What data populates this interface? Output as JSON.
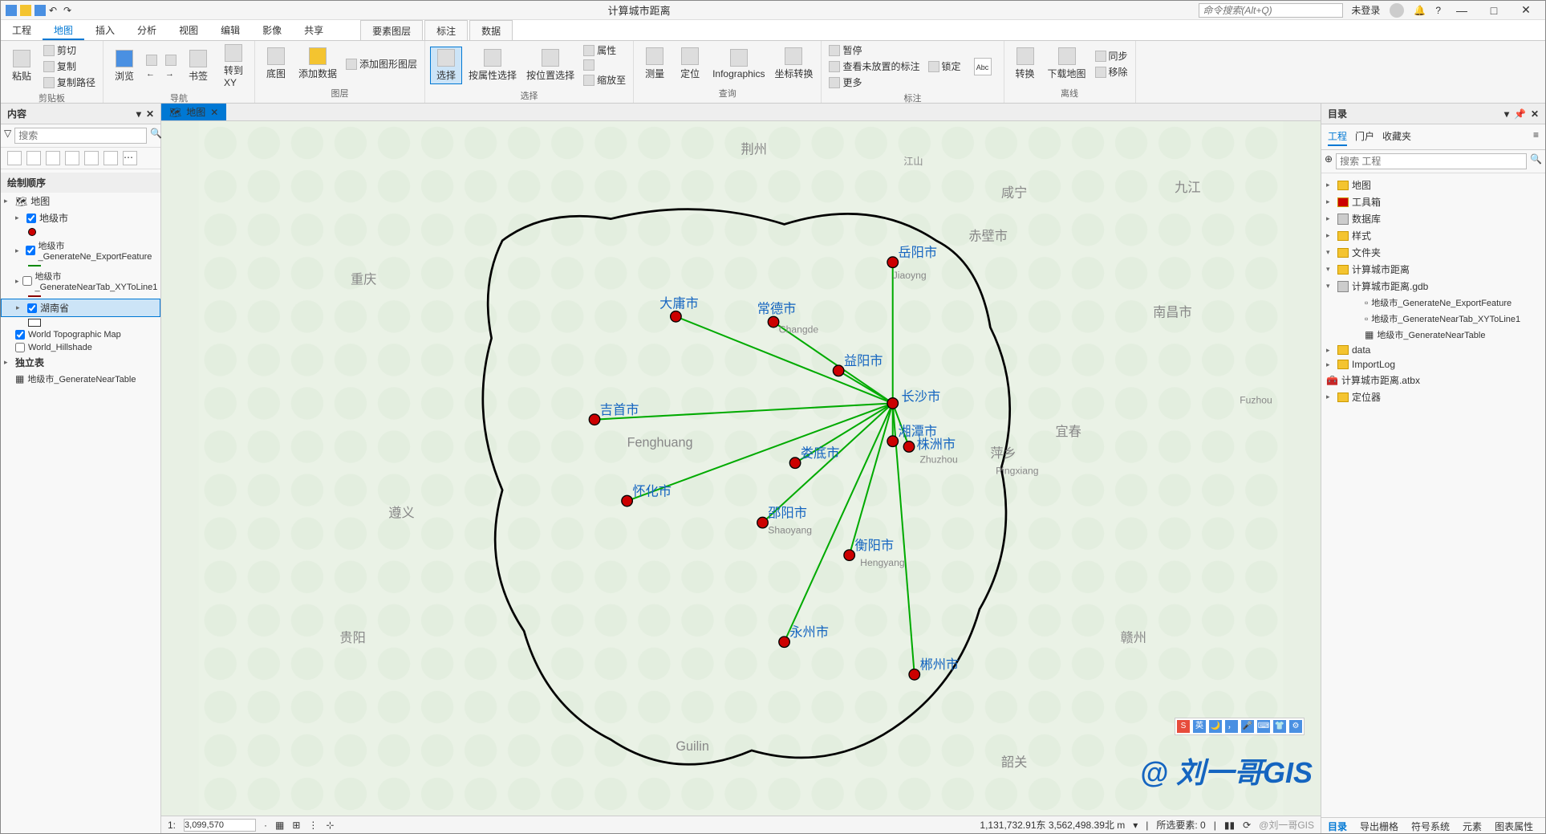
{
  "title": "计算城市距离",
  "search_placeholder": "命令搜索(Alt+Q)",
  "login": "未登录",
  "tabs": {
    "t0": "工程",
    "t1": "地图",
    "t2": "插入",
    "t3": "分析",
    "t4": "视图",
    "t5": "编辑",
    "t6": "影像",
    "t7": "共享",
    "c1": "要素图层",
    "c2": "标注",
    "c3": "数据"
  },
  "ribbon": {
    "clipboard": {
      "label": "剪贴板",
      "paste": "粘贴",
      "cut": "剪切",
      "copy": "复制",
      "copypath": "复制路径"
    },
    "nav": {
      "label": "导航",
      "browse": "浏览",
      "bookmark": "书签",
      "goto": "转到\nXY"
    },
    "layer": {
      "label": "图层",
      "basemap": "底图",
      "adddata": "添加数据",
      "addgfx": "添加图形图层"
    },
    "sel": {
      "label": "选择",
      "select": "选择",
      "byattr": "按属性选择",
      "byloc": "按位置选择",
      "attr": "属性",
      "zoomto": "缩放至"
    },
    "query": {
      "label": "查询",
      "measure": "测量",
      "locate": "定位",
      "info": "Infographics",
      "coord": "坐标转换"
    },
    "annot": {
      "label": "标注",
      "pause": "暂停",
      "lock": "锁定",
      "unplaced": "查看未放置的标注",
      "more": "更多"
    },
    "offline": {
      "label": "离线",
      "convert": "转换",
      "download": "下载地图",
      "sync": "同步",
      "remove": "移除"
    }
  },
  "contents": {
    "title": "内容",
    "search": "搜索",
    "draworder": "绘制顺序",
    "map": "地图",
    "layers": {
      "l1": "地级市",
      "l2": "地级市_GenerateNe_ExportFeature",
      "l3": "地级市_GenerateNearTab_XYToLine1",
      "l4": "湖南省",
      "l5": "World Topographic Map",
      "l6": "World_Hillshade"
    },
    "standalone": "独立表",
    "table1": "地级市_GenerateNearTable"
  },
  "maptab": "地图",
  "cities": {
    "c1": "岳阳市",
    "c2": "大庸市",
    "c3": "常德市",
    "c4": "益阳市",
    "c5": "长沙市",
    "c6": "吉首市",
    "c7": "株洲市",
    "c8": "娄底市",
    "c9": "怀化市",
    "c10": "邵阳市",
    "c11": "衡阳市",
    "c12": "永州市",
    "c13": "郴州市",
    "c14": "湘潭市"
  },
  "bgcities": {
    "b1": "重庆",
    "b2": "贵阳",
    "b3": "南昌市",
    "b4": "咸宁",
    "b5": "宜春",
    "b6": "萍乡",
    "b7": "韶关",
    "b8": "九江",
    "b9": "赤壁市",
    "b10": "遵义",
    "b11": "Fenghuang",
    "b12": "Guilin",
    "b13": "荆州",
    "b14": "江山",
    "b15": "Pingxiang",
    "b16": "Hengyang",
    "b17": "Zhuzhou",
    "b18": "Changde",
    "b19": "赣州",
    "b20": "Fuzhou",
    "b21": "Shaoyang",
    "b22": "Jiaoyng"
  },
  "status": {
    "scale_prefix": "1:",
    "scale": "3,099,570",
    "coords": "1,131,732.91东 3,562,498.39北 m",
    "selected": "所选要素: 0"
  },
  "catalog": {
    "title": "目录",
    "tabs": {
      "t1": "工程",
      "t2": "门户",
      "t3": "收藏夹"
    },
    "search": "搜索 工程",
    "items": {
      "i1": "地图",
      "i2": "工具箱",
      "i3": "数据库",
      "i4": "样式",
      "i5": "文件夹",
      "i6": "计算城市距离",
      "i7": "计算城市距离.gdb",
      "i8": "地级市_GenerateNe_ExportFeature",
      "i9": "地级市_GenerateNearTab_XYToLine1",
      "i10": "地级市_GenerateNearTable",
      "i11": "data",
      "i12": "ImportLog",
      "i13": "计算城市距离.atbx",
      "i14": "定位器"
    }
  },
  "bottom": {
    "b1": "目录",
    "b2": "导出栅格",
    "b3": "符号系统",
    "b4": "元素",
    "b5": "图表属性"
  },
  "watermark": "@ 刘一哥GIS",
  "wm2": "@刘一哥GIS"
}
